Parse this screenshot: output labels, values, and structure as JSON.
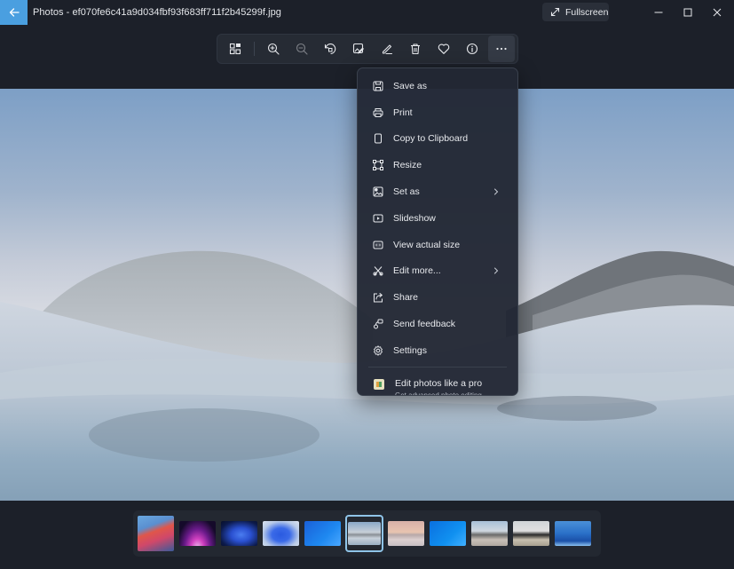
{
  "titlebar": {
    "title": "Photos - ef070fe6c41a9d034fbf93f683ff711f2b45299f.jpg",
    "fullscreen_label": "Fullscreen",
    "accent_color": "#4a9fe0"
  },
  "toolbar": {
    "buttons": [
      {
        "name": "gallery",
        "label": "Gallery view"
      },
      {
        "name": "zoom-in",
        "label": "Zoom in"
      },
      {
        "name": "zoom-out",
        "label": "Zoom out",
        "disabled": true
      },
      {
        "name": "rotate",
        "label": "Rotate"
      },
      {
        "name": "edit-image",
        "label": "Edit image"
      },
      {
        "name": "markup",
        "label": "Markup"
      },
      {
        "name": "delete",
        "label": "Delete"
      },
      {
        "name": "favorite",
        "label": "Favorite"
      },
      {
        "name": "info",
        "label": "File information"
      },
      {
        "name": "more",
        "label": "See more",
        "active": true
      }
    ]
  },
  "menu": {
    "items": [
      {
        "label": "Save as",
        "icon": "save-icon"
      },
      {
        "label": "Print",
        "icon": "print-icon"
      },
      {
        "label": "Copy to Clipboard",
        "icon": "copy-icon"
      },
      {
        "label": "Resize",
        "icon": "resize-icon"
      },
      {
        "label": "Set as",
        "icon": "set-as-icon",
        "submenu": true
      },
      {
        "label": "Slideshow",
        "icon": "slideshow-icon"
      },
      {
        "label": "View actual size",
        "icon": "actual-size-icon"
      },
      {
        "label": "Edit more...",
        "icon": "edit-more-icon",
        "submenu": true
      },
      {
        "label": "Share",
        "icon": "share-icon"
      },
      {
        "label": "Send feedback",
        "icon": "feedback-icon"
      },
      {
        "label": "Settings",
        "icon": "settings-icon"
      }
    ],
    "promo": {
      "label": "Edit photos like a pro",
      "sublabel": "Get advanced photo editing"
    }
  },
  "filmstrip": {
    "selected_index": 5,
    "thumbnails": [
      {
        "name": "macos-big-sur"
      },
      {
        "name": "purple-arc"
      },
      {
        "name": "blue-bloom-dark"
      },
      {
        "name": "blue-bloom-light"
      },
      {
        "name": "windows-blue"
      },
      {
        "name": "snowy-hills"
      },
      {
        "name": "pink-dunes"
      },
      {
        "name": "windows-10"
      },
      {
        "name": "desert-hills"
      },
      {
        "name": "dark-hills"
      },
      {
        "name": "blue-rain"
      }
    ]
  }
}
